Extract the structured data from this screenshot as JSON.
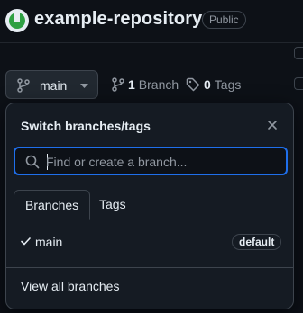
{
  "repo": {
    "name": "example-repository",
    "visibility": "Public"
  },
  "toolbar": {
    "current_branch": "main",
    "branch_count": "1",
    "branch_label": "Branch",
    "tag_count": "0",
    "tag_label": "Tags"
  },
  "dropdown": {
    "title": "Switch branches/tags",
    "search_placeholder": "Find or create a branch...",
    "search_value": "",
    "tabs": [
      {
        "label": "Branches",
        "active": true
      },
      {
        "label": "Tags",
        "active": false
      }
    ],
    "branches": [
      {
        "name": "main",
        "selected": true,
        "badge": "default"
      }
    ],
    "footer_link": "View all branches"
  },
  "colors": {
    "background": "#0d1117",
    "panel": "#151b23",
    "border": "#3d444d",
    "focus": "#1f6feb",
    "text": "#e6edf3",
    "muted": "#9198a1"
  }
}
